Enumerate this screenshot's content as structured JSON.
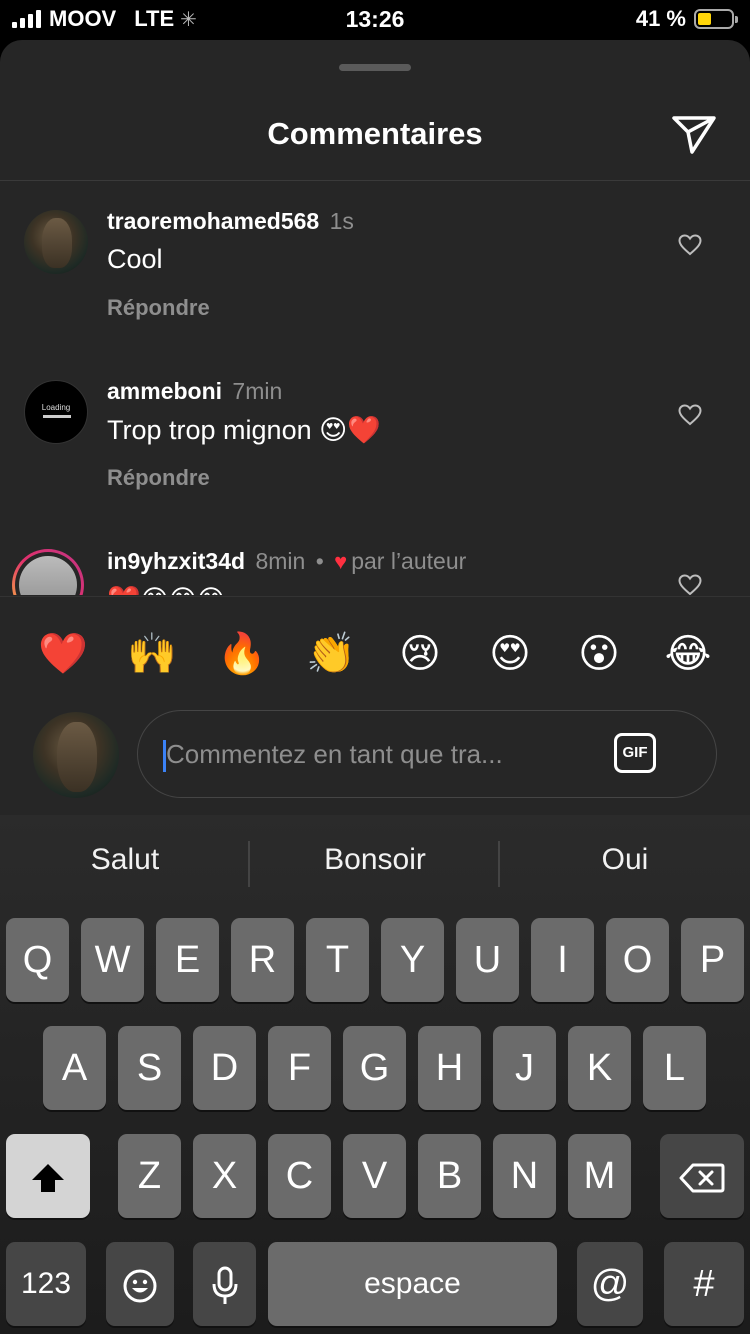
{
  "status_bar": {
    "carrier": "MOOV",
    "network": "LTE",
    "time": "13:26",
    "battery": "41 %",
    "battery_level": 0.41
  },
  "sheet": {
    "title": "Commentaires"
  },
  "comments": [
    {
      "username": "traoremohamed568",
      "time": "1s",
      "text": "Cool",
      "reply_label": "Répondre"
    },
    {
      "username": "ammeboni",
      "time": "7min",
      "text": "Trop trop mignon 😍❤️",
      "reply_label": "Répondre",
      "avatar_text": "Loading"
    },
    {
      "username": "in9yhzxit34d",
      "time": "8min",
      "separator": "•",
      "liked_by_author": "par l’auteur",
      "text": "❤️😁😁😁"
    }
  ],
  "reactions": [
    "❤️",
    "🙌",
    "🔥",
    "👏",
    "😢",
    "😍",
    "😮",
    "😂"
  ],
  "composer": {
    "placeholder": "Commentez en tant que tra...",
    "gif_label": "GIF"
  },
  "keyboard": {
    "suggestions": [
      "Salut",
      "Bonsoir",
      "Oui"
    ],
    "row1": [
      "Q",
      "W",
      "E",
      "R",
      "T",
      "Y",
      "U",
      "I",
      "O",
      "P"
    ],
    "row2": [
      "A",
      "S",
      "D",
      "F",
      "G",
      "H",
      "J",
      "K",
      "L"
    ],
    "row3": [
      "Z",
      "X",
      "C",
      "V",
      "B",
      "N",
      "M"
    ],
    "numbers_label": "123",
    "space_label": "espace",
    "at_label": "@",
    "hash_label": "#",
    "accent": "#3b82f6"
  }
}
